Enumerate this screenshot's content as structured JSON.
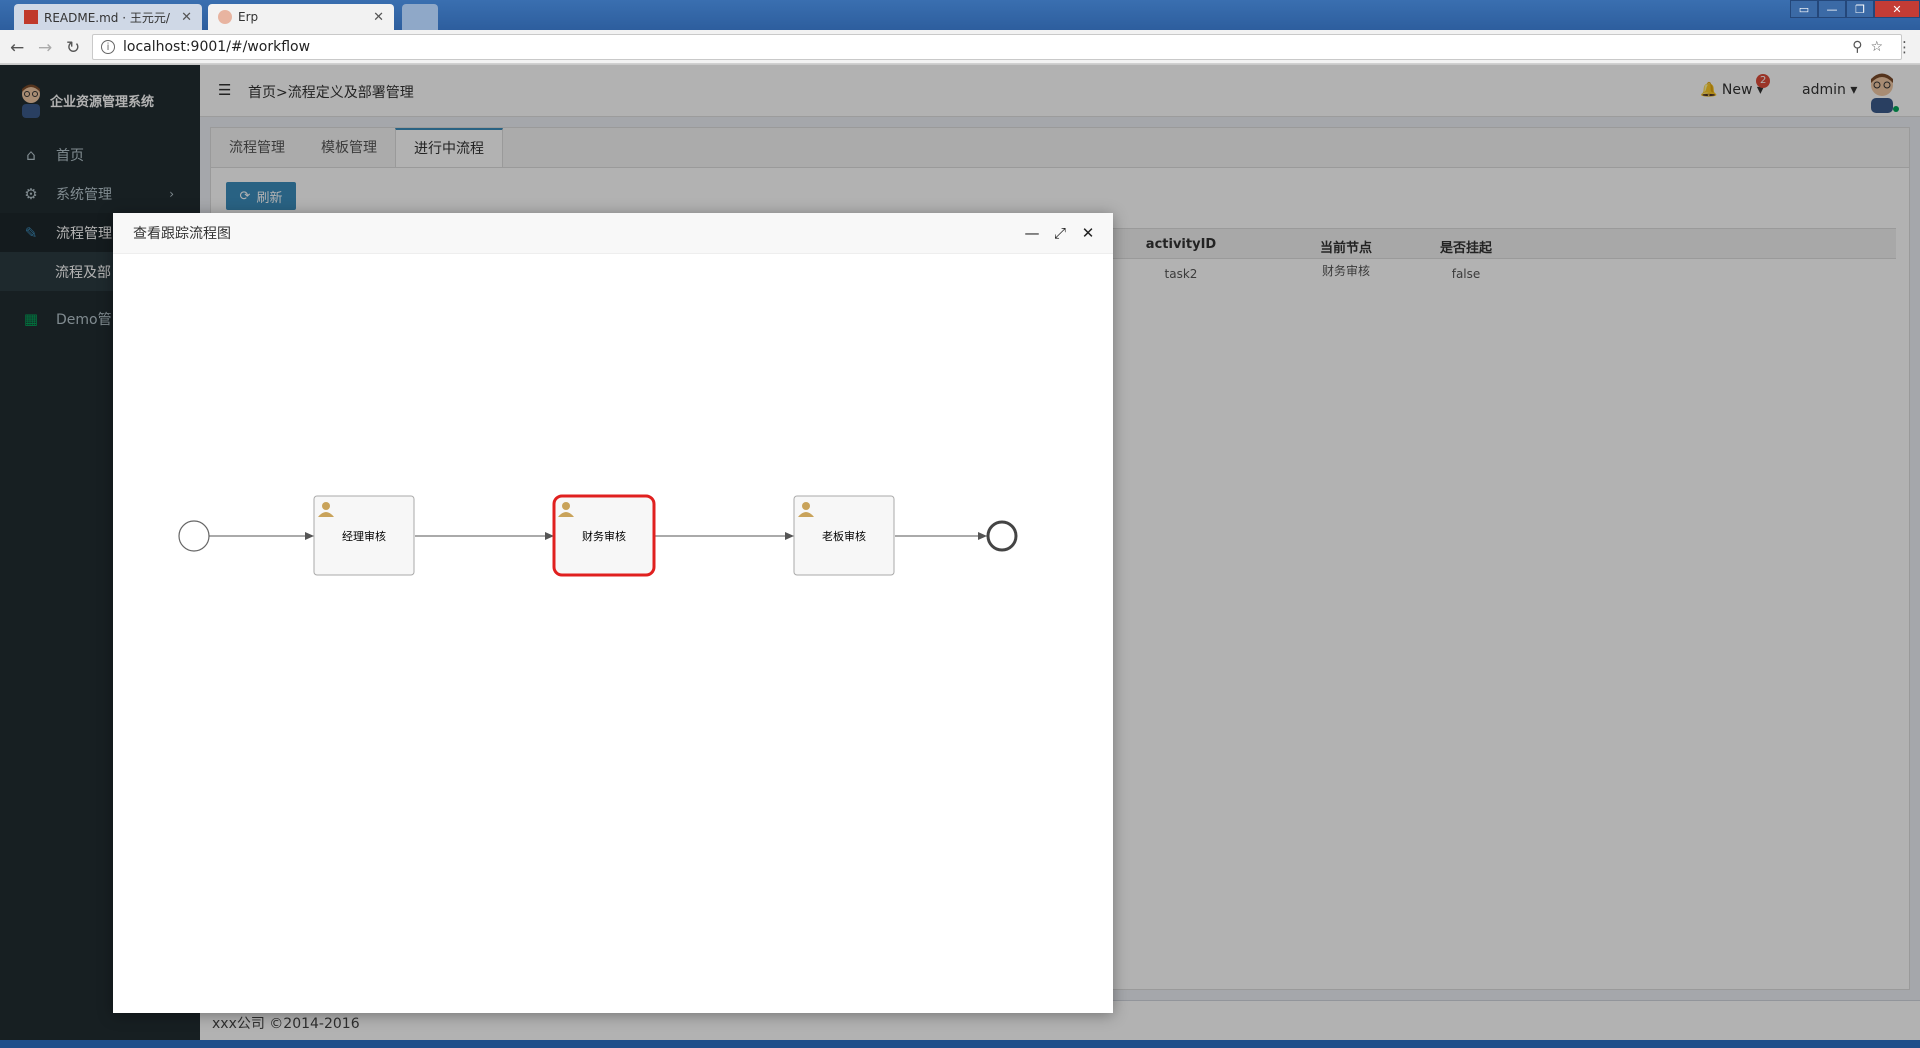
{
  "browser": {
    "tabs": [
      {
        "title": "README.md · 王元元/"
      },
      {
        "title": "Erp"
      }
    ],
    "url": "localhost:9001/#/workflow"
  },
  "app": {
    "brand": "企业资源管理系统",
    "sidebar": [
      {
        "label": "首页",
        "icon": "home-icon"
      },
      {
        "label": "系统管理",
        "icon": "gear-icon"
      },
      {
        "label": "流程管理",
        "icon": "pencil-icon"
      },
      {
        "label": "流程及部",
        "icon": ""
      },
      {
        "label": "Demo管",
        "icon": "grid-icon"
      }
    ],
    "breadcrumb": "首页>流程定义及部署管理",
    "notify_label": "New",
    "notify_count": "2",
    "user": "admin",
    "tabs": [
      "流程管理",
      "模板管理",
      "进行中流程"
    ],
    "refresh_label": "刷新",
    "table": {
      "headers": [
        "activityID",
        "当前节点",
        "是否挂起"
      ],
      "rows": [
        [
          "task2",
          "财务审核",
          "false"
        ]
      ]
    },
    "footer": "xxx公司 ©2014-2016"
  },
  "modal": {
    "title": "查看跟踪流程图",
    "nodes": [
      {
        "label": "经理审核",
        "current": false
      },
      {
        "label": "财务审核",
        "current": true
      },
      {
        "label": "老板审核",
        "current": false
      }
    ]
  },
  "colors": {
    "sidebar_bg": "#222d32",
    "accent": "#3c8dbc",
    "current_node": "#e0201f"
  }
}
